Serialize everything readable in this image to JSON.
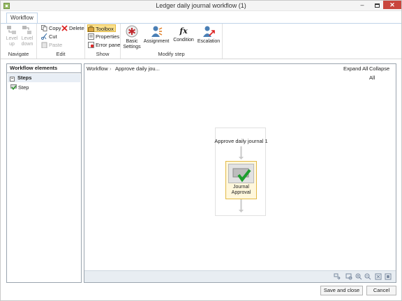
{
  "window": {
    "title": "Ledger daily journal workflow (1)"
  },
  "ribbon": {
    "tab": "Workflow",
    "navigate": {
      "label": "Navigate",
      "level_up": "Level up",
      "level_down": "Level down"
    },
    "edit": {
      "label": "Edit",
      "copy": "Copy",
      "delete": "Delete",
      "cut": "Cut",
      "paste": "Paste"
    },
    "show": {
      "label": "Show",
      "toolbox": "Toolbox",
      "properties": "Properties",
      "error_pane": "Error pane"
    },
    "modify_step": {
      "label": "Modify step",
      "basic_settings": "Basic Settings",
      "assignment": "Assignment",
      "condition": "Condition",
      "escalation": "Escalation"
    }
  },
  "elements": {
    "header": "Workflow elements",
    "group": "Steps",
    "items": [
      "Step"
    ]
  },
  "designer": {
    "breadcrumb": [
      "Workflow",
      "Approve daily jou..."
    ],
    "expand_all": "Expand All",
    "collapse_all": "Collapse All",
    "flow_title": "Approve daily journal 1",
    "node_label": "Journal Approval"
  },
  "footer": {
    "save": "Save and close",
    "cancel": "Cancel"
  },
  "colors": {
    "accent": "#e2b945",
    "selection": "#fbe08a",
    "close": "#c9463d"
  }
}
